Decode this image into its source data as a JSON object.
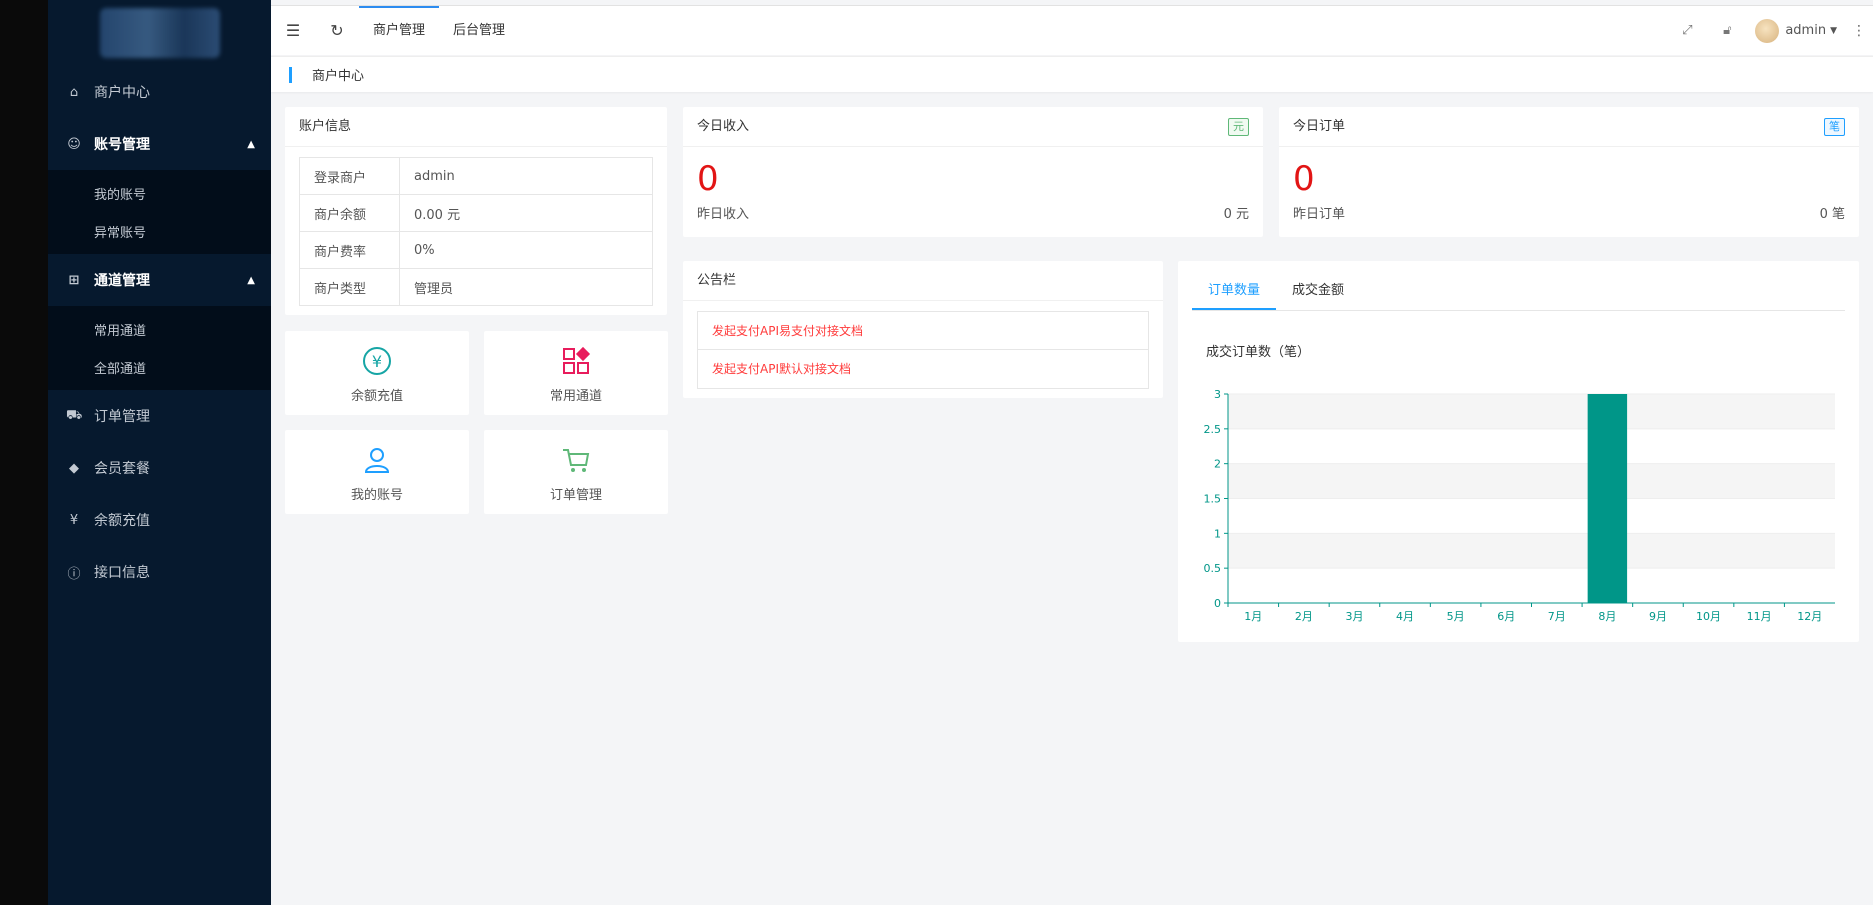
{
  "sidebar": {
    "items": [
      {
        "label": "商户中心",
        "icon": "home-icon"
      },
      {
        "label": "账号管理",
        "icon": "user-group-icon",
        "expanded": true,
        "children": [
          "我的账号",
          "异常账号"
        ]
      },
      {
        "label": "通道管理",
        "icon": "channel-icon",
        "expanded": true,
        "children": [
          "常用通道",
          "全部通道"
        ]
      },
      {
        "label": "订单管理",
        "icon": "cart-icon"
      },
      {
        "label": "会员套餐",
        "icon": "diamond-icon"
      },
      {
        "label": "余额充值",
        "icon": "yen-icon"
      },
      {
        "label": "接口信息",
        "icon": "info-icon"
      }
    ]
  },
  "topbar": {
    "tabs": [
      "商户管理",
      "后台管理"
    ],
    "active_tab": "商户管理",
    "user": "admin"
  },
  "breadcrumb": "商户中心",
  "account": {
    "title": "账户信息",
    "rows": [
      {
        "key": "登录商户",
        "value": "admin"
      },
      {
        "key": "商户余额",
        "value": "0.00 元"
      },
      {
        "key": "商户费率",
        "value": "0%"
      },
      {
        "key": "商户类型",
        "value": "管理员"
      }
    ]
  },
  "quick_links": [
    {
      "label": "余额充值",
      "icon": "yen-circle-icon",
      "color": "#16a5a5"
    },
    {
      "label": "常用通道",
      "icon": "grid-icon",
      "color": "#e81c5c"
    },
    {
      "label": "我的账号",
      "icon": "user-icon",
      "color": "#1e9fff"
    },
    {
      "label": "订单管理",
      "icon": "cart-icon",
      "color": "#5fb878"
    }
  ],
  "income": {
    "title": "今日收入",
    "badge": "元",
    "value": "0",
    "sub_label": "昨日收入",
    "sub_value": "0 元"
  },
  "orders": {
    "title": "今日订单",
    "badge": "笔",
    "value": "0",
    "sub_label": "昨日订单",
    "sub_value": "0 笔"
  },
  "notice": {
    "title": "公告栏",
    "items": [
      "发起支付API易支付对接文档",
      "发起支付API默认对接文档"
    ]
  },
  "chart_tabs": [
    "订单数量",
    "成交金额"
  ],
  "chart_data": {
    "type": "bar",
    "title": "成交订单数（笔）",
    "categories": [
      "1月",
      "2月",
      "3月",
      "4月",
      "5月",
      "6月",
      "7月",
      "8月",
      "9月",
      "10月",
      "11月",
      "12月"
    ],
    "values": [
      0,
      0,
      0,
      0,
      0,
      0,
      0,
      3,
      0,
      0,
      0,
      0
    ],
    "ylim": [
      0,
      3
    ],
    "yticks": [
      "0",
      "0.5",
      "1",
      "1.5",
      "2",
      "2.5",
      "3"
    ],
    "bar_color": "#009688",
    "axis_color": "#009688"
  }
}
